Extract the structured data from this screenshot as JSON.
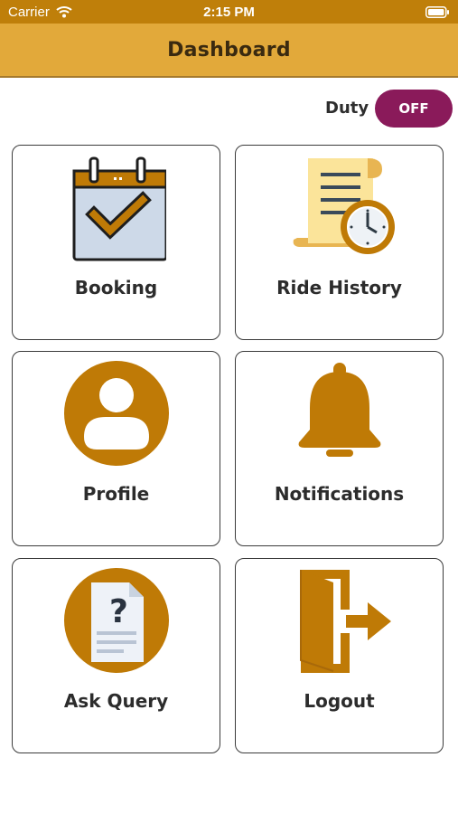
{
  "status_bar": {
    "carrier": "Carrier",
    "time": "2:15 PM",
    "wifi_icon": "wifi-icon",
    "battery_icon": "battery-icon"
  },
  "header": {
    "title": "Dashboard"
  },
  "duty": {
    "label": "Duty",
    "toggle_text": "OFF"
  },
  "tiles": [
    {
      "label": "Booking",
      "icon": "calendar-check-icon"
    },
    {
      "label": "Ride History",
      "icon": "scroll-clock-icon"
    },
    {
      "label": "Profile",
      "icon": "user-circle-icon"
    },
    {
      "label": "Notifications",
      "icon": "bell-icon"
    },
    {
      "label": "Ask Query",
      "icon": "question-document-icon"
    },
    {
      "label": "Logout",
      "icon": "exit-door-icon"
    }
  ],
  "colors": {
    "status_bar": "#bf7f0a",
    "header": "#e2a93a",
    "accent": "#bf7a06",
    "toggle": "#8a1a5a"
  }
}
